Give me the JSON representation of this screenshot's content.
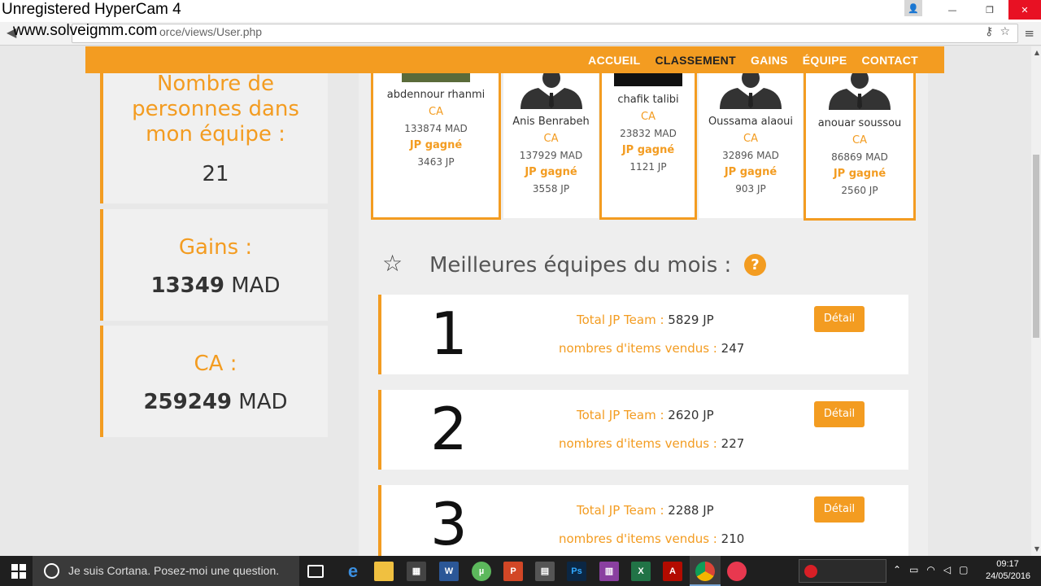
{
  "watermark": {
    "line1": "Unregistered HyperCam 4",
    "line2": "www.solveigmm.com"
  },
  "browser": {
    "url": "orce/views/User.php",
    "window_buttons": {
      "minimize": "—",
      "restore": "❐",
      "close": "✕"
    }
  },
  "nav": {
    "items": [
      {
        "label": "ACCUEIL",
        "active": false
      },
      {
        "label": "CLASSEMENT",
        "active": true
      },
      {
        "label": "GAINS",
        "active": false
      },
      {
        "label": "ÉQUIPE",
        "active": false
      },
      {
        "label": "CONTACT",
        "active": false
      }
    ]
  },
  "stats": {
    "team_count": {
      "title": "Nombre de personnes dans mon équipe :",
      "value": "21"
    },
    "gains": {
      "title": "Gains :",
      "value": "13349",
      "unit": "MAD"
    },
    "ca": {
      "title": "CA :",
      "value": "259249",
      "unit": "MAD"
    }
  },
  "members": [
    {
      "name": "abdennour rhanmi",
      "ca_label": "CA",
      "ca": "133874 MAD",
      "jp_label": "JP gagné",
      "jp": "3463 JP"
    },
    {
      "name": "Anis Benrabeh",
      "ca_label": "CA",
      "ca": "137929 MAD",
      "jp_label": "JP gagné",
      "jp": "3558 JP"
    },
    {
      "name": "chafik talibi",
      "ca_label": "CA",
      "ca": "23832 MAD",
      "jp_label": "JP gagné",
      "jp": "1121 JP"
    },
    {
      "name": "Oussama alaoui",
      "ca_label": "CA",
      "ca": "32896 MAD",
      "jp_label": "JP gagné",
      "jp": "903 JP"
    },
    {
      "name": "anouar soussou",
      "ca_label": "CA",
      "ca": "86869 MAD",
      "jp_label": "JP gagné",
      "jp": "2560 JP"
    }
  ],
  "teams_section": {
    "title": "Meilleures équipes du mois :",
    "help": "?"
  },
  "teams": [
    {
      "rank": "1",
      "jp_label": "Total JP Team :",
      "jp": "5829 JP",
      "items_label": "nombres d'items vendus :",
      "items": "247",
      "button": "Détail"
    },
    {
      "rank": "2",
      "jp_label": "Total JP Team :",
      "jp": "2620 JP",
      "items_label": "nombres d'items vendus :",
      "items": "227",
      "button": "Détail"
    },
    {
      "rank": "3",
      "jp_label": "Total JP Team :",
      "jp": "2288 JP",
      "items_label": "nombres d'items vendus :",
      "items": "210",
      "button": "Détail"
    }
  ],
  "taskbar": {
    "cortana": "Je suis Cortana. Posez-moi une question.",
    "time": "09:17",
    "date": "24/05/2016"
  },
  "colors": {
    "accent": "#f39c21",
    "taskbar": "#1f1f1f"
  }
}
